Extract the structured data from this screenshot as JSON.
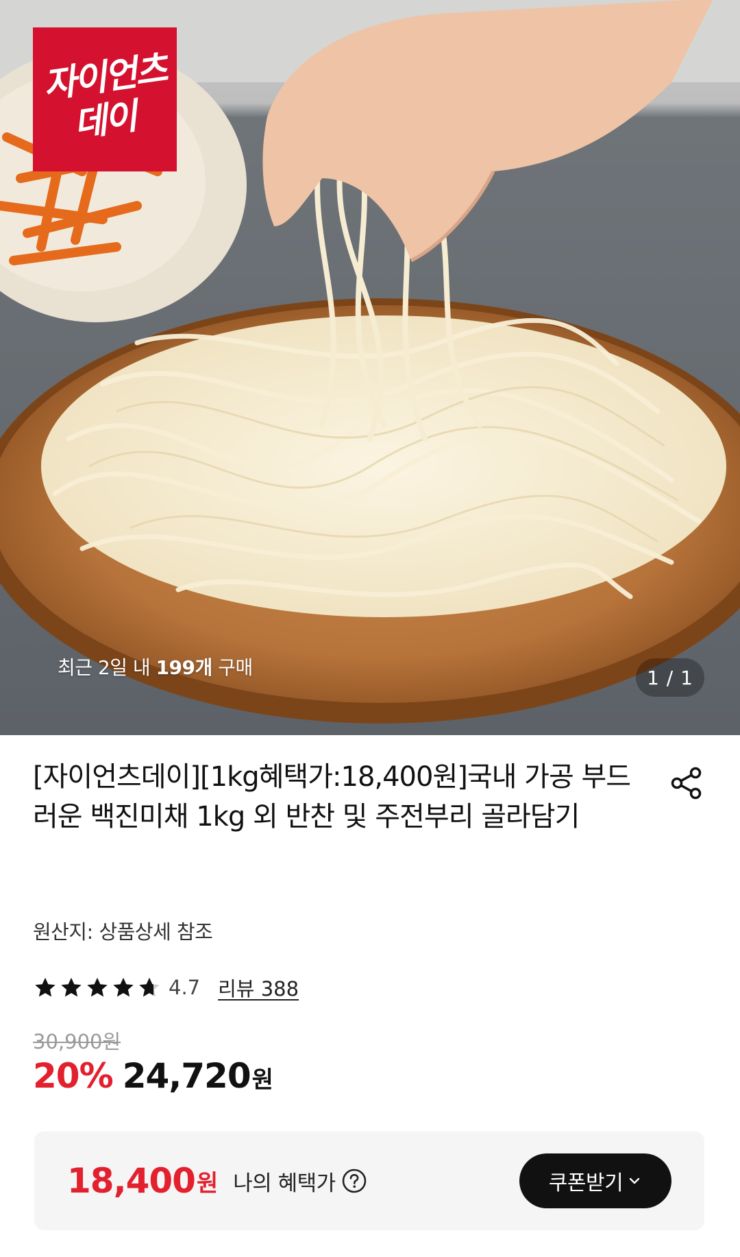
{
  "hero": {
    "brand_badge_line1": "자이언츠",
    "brand_badge_line2": "데이",
    "recent_purchase": {
      "prefix": "최근 2일 내 ",
      "count": "199개",
      "suffix": " 구매"
    },
    "image_counter": "1 / 1"
  },
  "product": {
    "title": "[자이언츠데이][1kg혜택가:18,400원]국내 가공 부드러운 백진미채 1kg 외 반찬 및 주전부리 골라담기",
    "origin": "원산지: 상품상세 참조",
    "rating": "4.7",
    "rating_stars": 4.7,
    "review_link": "리뷰 388",
    "original_price": "30,900원",
    "discount": "20%",
    "sale_price": "24,720",
    "currency": "원"
  },
  "benefit": {
    "price": "18,400",
    "currency": "원",
    "label": "나의 혜택가",
    "coupon_button": "쿠폰받기"
  },
  "colors": {
    "accent_red": "#e3202d",
    "brand_red": "#d4112e",
    "button_dark": "#111111",
    "benefit_bg": "#f5f5f6"
  },
  "icons": {
    "share": "share-icon",
    "star": "star-icon",
    "help": "question-circle-icon",
    "chevron": "chevron-down-icon"
  }
}
